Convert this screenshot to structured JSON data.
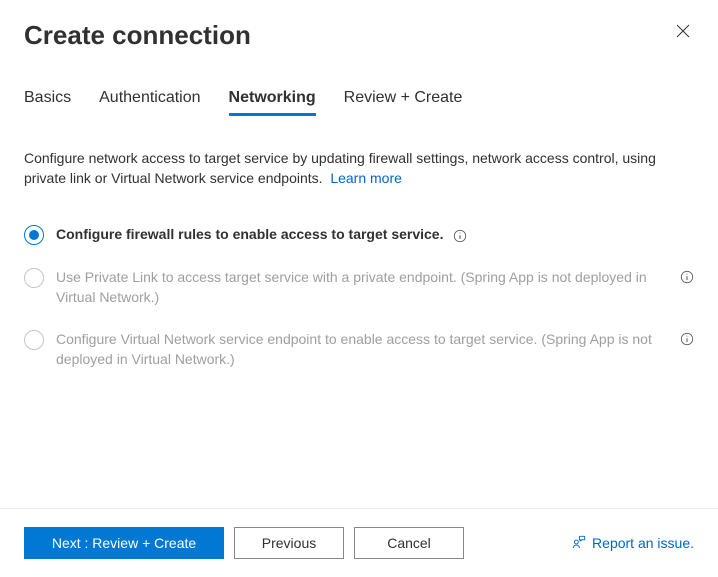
{
  "header": {
    "title": "Create connection"
  },
  "tabs": [
    {
      "label": "Basics",
      "active": false
    },
    {
      "label": "Authentication",
      "active": false
    },
    {
      "label": "Networking",
      "active": true
    },
    {
      "label": "Review + Create",
      "active": false
    }
  ],
  "description": {
    "text": "Configure network access to target service by updating firewall settings, network access control, using private link or Virtual Network service endpoints.",
    "learn_more": "Learn more"
  },
  "options": [
    {
      "label": "Configure firewall rules to enable access to target service.",
      "selected": true,
      "disabled": false,
      "info_inline": true
    },
    {
      "label": "Use Private Link to access target service with a private endpoint. (Spring App is not deployed in Virtual Network.)",
      "selected": false,
      "disabled": true,
      "info_right": true
    },
    {
      "label": "Configure Virtual Network service endpoint to enable access to target service. (Spring App is not deployed in Virtual Network.)",
      "selected": false,
      "disabled": true,
      "info_right": true
    }
  ],
  "footer": {
    "primary": "Next : Review + Create",
    "previous": "Previous",
    "cancel": "Cancel",
    "report": "Report an issue."
  }
}
